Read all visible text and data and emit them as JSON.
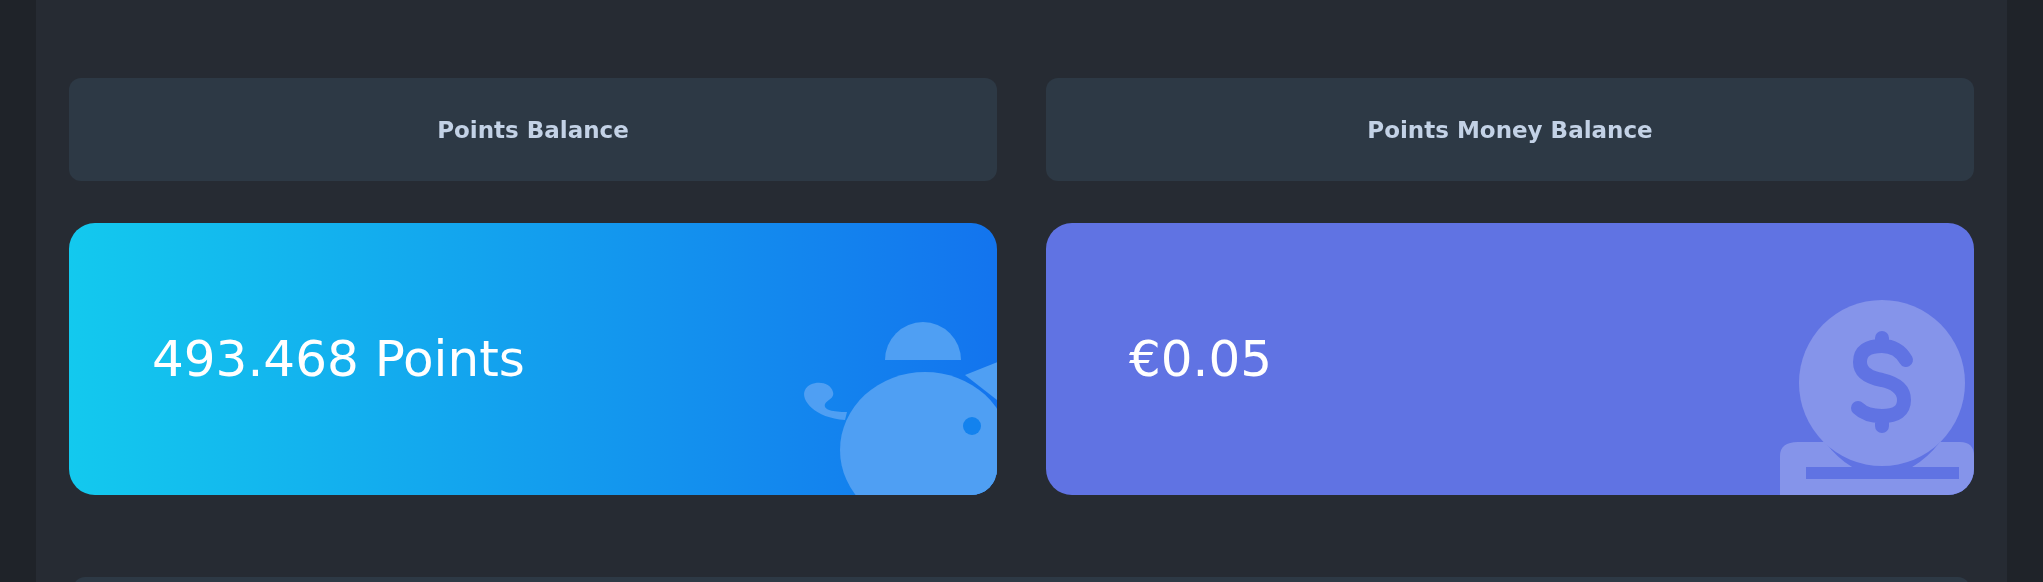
{
  "balances": [
    {
      "kind": "points",
      "title": "Points Balance",
      "value": "493.468 Points"
    },
    {
      "kind": "money",
      "title": "Points Money Balance",
      "value": "€0.05"
    }
  ]
}
